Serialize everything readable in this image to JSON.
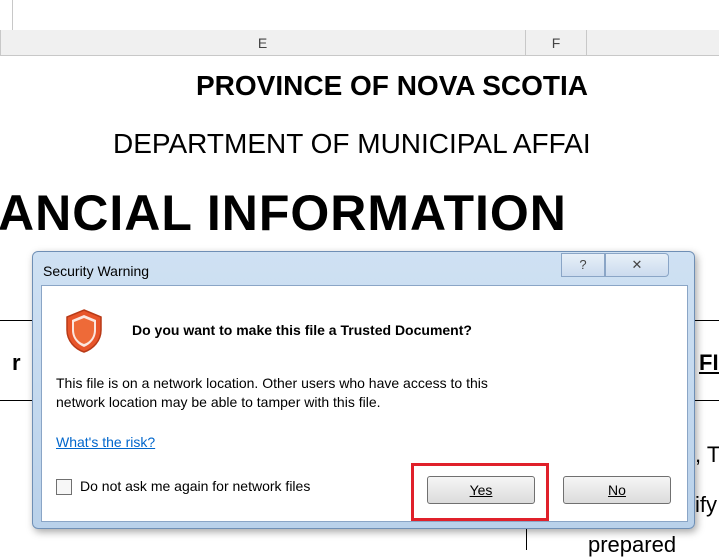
{
  "sheet": {
    "column_headers": [
      "E",
      "F"
    ],
    "line1": "PROVINCE OF NOVA SCOTIA",
    "line2": "DEPARTMENT OF MUNICIPAL AFFAI",
    "line3": "ANCIAL INFORMATION",
    "fragment_left": "r",
    "fragment_fic": "FIC",
    "fragment_t": ", T",
    "fragment_ify": "ify",
    "fragment_prepared": "prepared"
  },
  "dialog": {
    "title": "Security Warning",
    "help_glyph": "?",
    "close_glyph": "✕",
    "heading": "Do you want to make this file a Trusted Document?",
    "body_line1": "This file is on a network location. Other users who have access to this",
    "body_line2": "network location may be able to tamper with this file.",
    "risk_link": "What's the risk?",
    "checkbox_label": "Do not ask me again for network files",
    "checkbox_checked": false,
    "yes_label": "Yes",
    "no_label": "No",
    "shield_color": "#e8552a",
    "highlight_color": "#e0202a"
  }
}
